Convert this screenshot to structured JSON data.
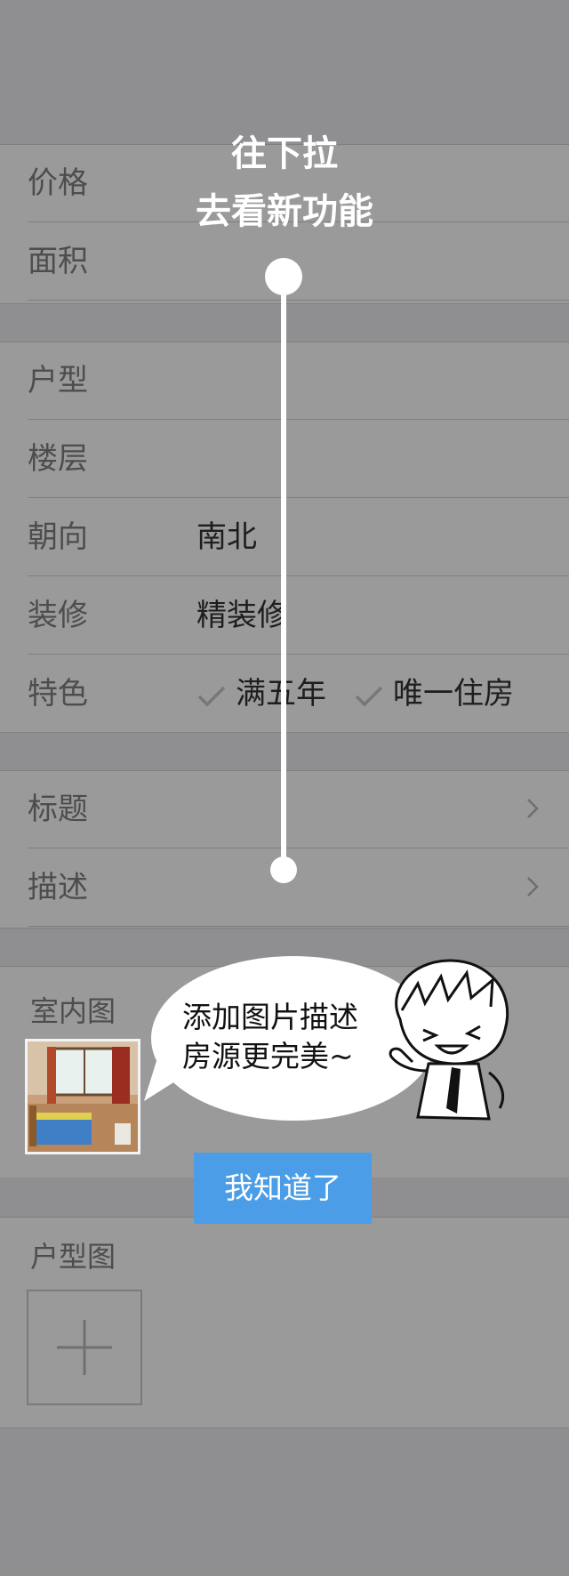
{
  "form": {
    "group1": [
      {
        "label": "价格",
        "value": ""
      },
      {
        "label": "面积",
        "value": ""
      }
    ],
    "group2": [
      {
        "label": "户型",
        "value": ""
      },
      {
        "label": "楼层",
        "value": ""
      },
      {
        "label": "朝向",
        "value": "南北"
      },
      {
        "label": "装修",
        "value": "精装修"
      },
      {
        "label": "特色",
        "features": [
          "满五年",
          "唯一住房"
        ]
      }
    ],
    "group3": [
      {
        "label": "标题"
      },
      {
        "label": "描述"
      }
    ]
  },
  "indoor_photos": {
    "title": "室内图"
  },
  "floor_plan": {
    "title": "户型图"
  },
  "overlay": {
    "pull_line1": "往下拉",
    "pull_line2": "去看新功能",
    "bubble_line1": "添加图片描述",
    "bubble_line2": "房源更完美~",
    "got_it": "我知道了"
  },
  "icons": {
    "check": "check-icon",
    "chevron": "chevron-right-icon",
    "add": "plus-icon"
  },
  "colors": {
    "accent": "#4a9de6",
    "overlay_bg": "#8f8f91"
  }
}
